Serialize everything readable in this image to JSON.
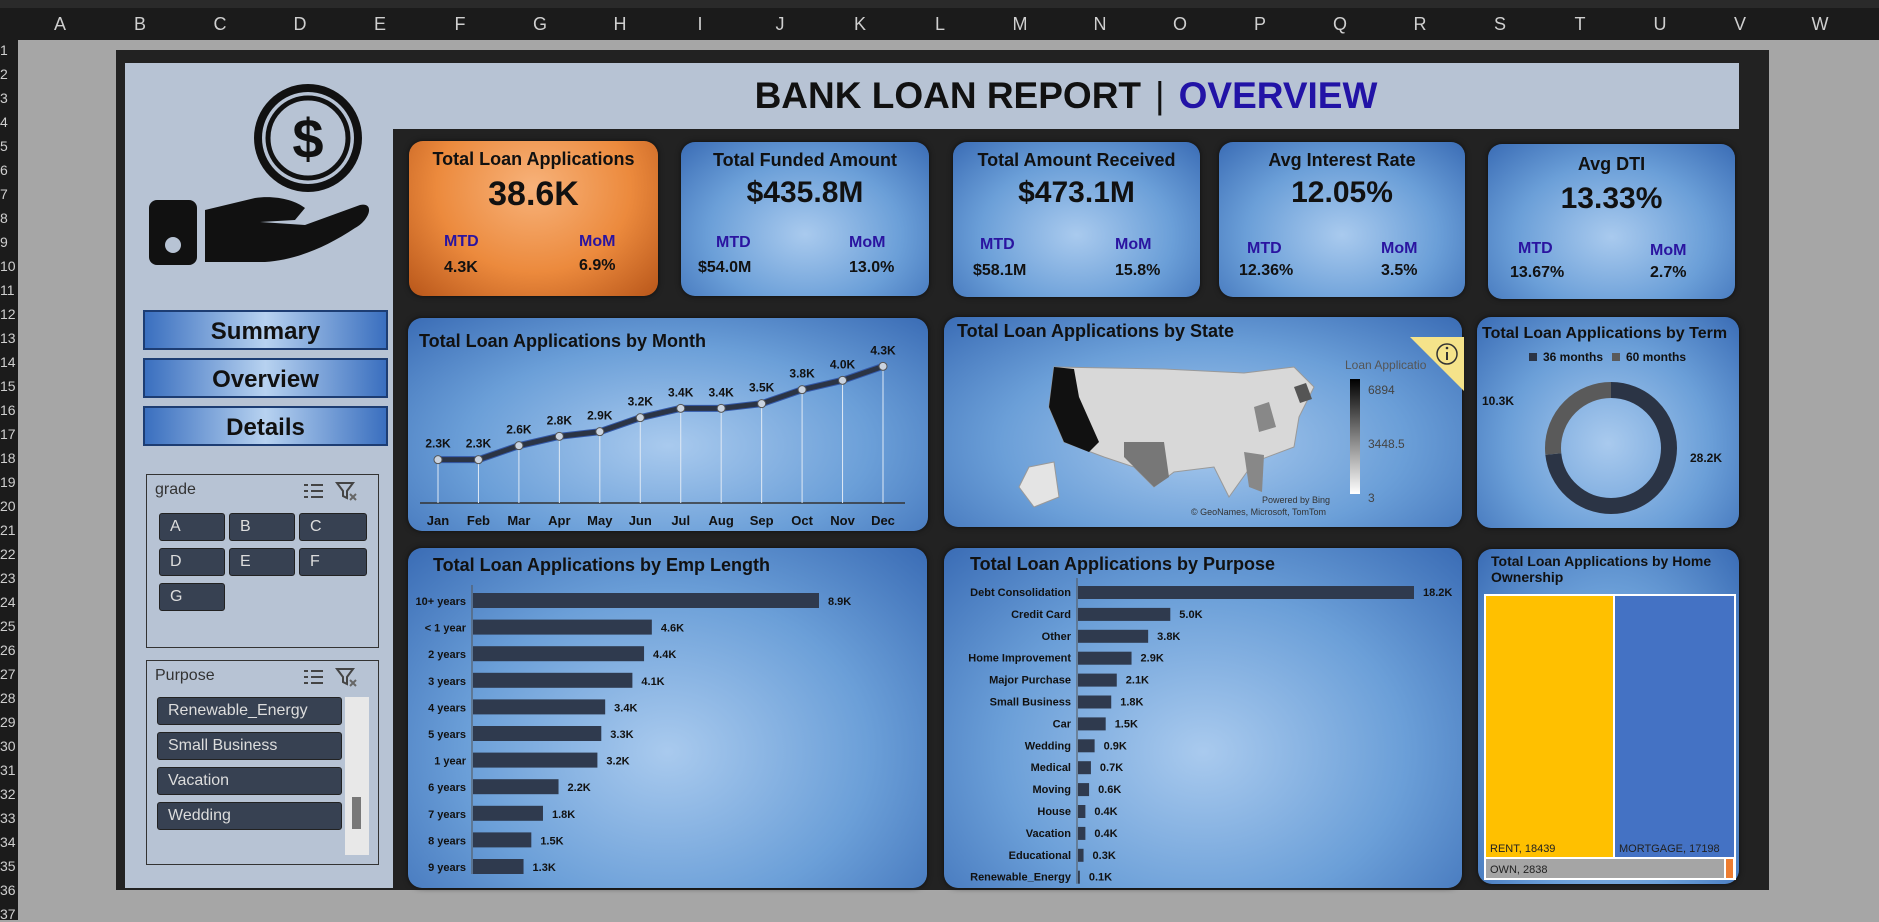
{
  "columns": [
    "A",
    "B",
    "C",
    "D",
    "E",
    "F",
    "G",
    "H",
    "I",
    "J",
    "K",
    "L",
    "M",
    "N",
    "O",
    "P",
    "Q",
    "R",
    "S",
    "T",
    "U",
    "V",
    "W"
  ],
  "rows": [
    "1",
    "2",
    "3",
    "4",
    "5",
    "6",
    "7",
    "8",
    "9",
    "10",
    "11",
    "12",
    "13",
    "14",
    "15",
    "16",
    "17",
    "18",
    "19",
    "20",
    "21",
    "22",
    "23",
    "24",
    "25",
    "26",
    "27",
    "28",
    "29",
    "30",
    "31",
    "32",
    "33",
    "34",
    "35",
    "36",
    "37"
  ],
  "title": {
    "main": "BANK LOAN REPORT",
    "separator": "|",
    "sub": "OVERVIEW"
  },
  "nav": {
    "summary": "Summary",
    "overview": "Overview",
    "details": "Details"
  },
  "kpis": [
    {
      "title": "Total Loan Applications",
      "value": "38.6K",
      "mtd_label": "MTD",
      "mtd": "4.3K",
      "mom_label": "MoM",
      "mom": "6.9%"
    },
    {
      "title": "Total Funded Amount",
      "value": "$435.8M",
      "mtd_label": "MTD",
      "mtd": "$54.0M",
      "mom_label": "MoM",
      "mom": "13.0%"
    },
    {
      "title": "Total Amount Received",
      "value": "$473.1M",
      "mtd_label": "MTD",
      "mtd": "$58.1M",
      "mom_label": "MoM",
      "mom": "15.8%"
    },
    {
      "title": "Avg Interest Rate",
      "value": "12.05%",
      "mtd_label": "MTD",
      "mtd": "12.36%",
      "mom_label": "MoM",
      "mom": "3.5%"
    },
    {
      "title": "Avg DTI",
      "value": "13.33%",
      "mtd_label": "MTD",
      "mtd": "13.67%",
      "mom_label": "MoM",
      "mom": "2.7%"
    }
  ],
  "slicers": {
    "grade": {
      "header": "grade",
      "items": [
        "A",
        "B",
        "C",
        "D",
        "E",
        "F",
        "G"
      ]
    },
    "purpose": {
      "header": "Purpose",
      "items": [
        "Renewable_Energy",
        "Small Business",
        "Vacation",
        "Wedding"
      ]
    }
  },
  "map": {
    "title": "Total Loan Applications by State",
    "legend_title": "Loan Applicatio",
    "legend_max": "6894",
    "legend_mid": "3448.5",
    "legend_min": "3",
    "powered": "Powered by Bing",
    "credit": "© GeoNames, Microsoft, TomTom",
    "info_icon": "info-icon"
  },
  "chart_data": [
    {
      "type": "line",
      "title": "Total Loan Applications by Month",
      "categories": [
        "Jan",
        "Feb",
        "Mar",
        "Apr",
        "May",
        "Jun",
        "Jul",
        "Aug",
        "Sep",
        "Oct",
        "Nov",
        "Dec"
      ],
      "values": [
        2.3,
        2.3,
        2.6,
        2.8,
        2.9,
        3.2,
        3.4,
        3.4,
        3.5,
        3.8,
        4.0,
        4.3
      ],
      "labels": [
        "2.3K",
        "2.3K",
        "2.6K",
        "2.8K",
        "2.9K",
        "3.2K",
        "3.4K",
        "3.4K",
        "3.5K",
        "3.8K",
        "4.0K",
        "4.3K"
      ]
    },
    {
      "type": "pie",
      "title": "Total Loan Applications by Term",
      "categories": [
        "36 months",
        "60 months"
      ],
      "values": [
        28.2,
        10.3
      ],
      "labels": [
        "28.2K",
        "10.3K"
      ],
      "colors": [
        "#2b3445",
        "#5a5a5a"
      ]
    },
    {
      "type": "bar",
      "title": "Total Loan Applications by Emp Length",
      "categories": [
        "10+ years",
        "< 1 year",
        "2 years",
        "3 years",
        "4 years",
        "5 years",
        "1 year",
        "6 years",
        "7 years",
        "8 years",
        "9 years"
      ],
      "values": [
        8.9,
        4.6,
        4.4,
        4.1,
        3.4,
        3.3,
        3.2,
        2.2,
        1.8,
        1.5,
        1.3
      ],
      "labels": [
        "8.9K",
        "4.6K",
        "4.4K",
        "4.1K",
        "3.4K",
        "3.3K",
        "3.2K",
        "2.2K",
        "1.8K",
        "1.5K",
        "1.3K"
      ]
    },
    {
      "type": "bar",
      "title": "Total Loan Applications by Purpose",
      "categories": [
        "Debt Consolidation",
        "Credit Card",
        "Other",
        "Home Improvement",
        "Major Purchase",
        "Small Business",
        "Car",
        "Wedding",
        "Medical",
        "Moving",
        "House",
        "Vacation",
        "Educational",
        "Renewable_Energy"
      ],
      "values": [
        18.2,
        5.0,
        3.8,
        2.9,
        2.1,
        1.8,
        1.5,
        0.9,
        0.7,
        0.6,
        0.4,
        0.4,
        0.3,
        0.1
      ],
      "labels": [
        "18.2K",
        "5.0K",
        "3.8K",
        "2.9K",
        "2.1K",
        "1.8K",
        "1.5K",
        "0.9K",
        "0.7K",
        "0.6K",
        "0.4K",
        "0.4K",
        "0.3K",
        "0.1K"
      ]
    },
    {
      "type": "treemap",
      "title": "Total Loan Applications by Home Ownership",
      "categories": [
        "RENT",
        "MORTGAGE",
        "OWN"
      ],
      "values": [
        18439,
        17198,
        2838
      ],
      "labels": [
        "RENT, 18439",
        "MORTGAGE, 17198",
        "OWN, 2838"
      ],
      "colors": [
        "#ffc000",
        "#4472c4",
        "#a5a5a5"
      ]
    }
  ]
}
